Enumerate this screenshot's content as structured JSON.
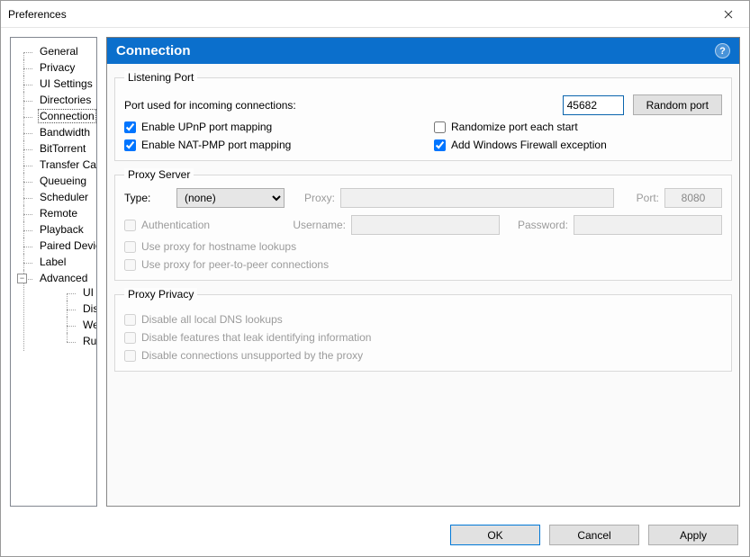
{
  "window": {
    "title": "Preferences"
  },
  "sidebar": {
    "items": [
      {
        "label": "General"
      },
      {
        "label": "Privacy"
      },
      {
        "label": "UI Settings"
      },
      {
        "label": "Directories"
      },
      {
        "label": "Connection",
        "selected": true
      },
      {
        "label": "Bandwidth"
      },
      {
        "label": "BitTorrent"
      },
      {
        "label": "Transfer Cap"
      },
      {
        "label": "Queueing"
      },
      {
        "label": "Scheduler"
      },
      {
        "label": "Remote"
      },
      {
        "label": "Playback"
      },
      {
        "label": "Paired Devices"
      },
      {
        "label": "Label"
      },
      {
        "label": "Advanced",
        "expanded": true,
        "children": [
          {
            "label": "UI Extras"
          },
          {
            "label": "Disk Cache"
          },
          {
            "label": "Web UI"
          },
          {
            "label": "Run Program"
          }
        ]
      }
    ]
  },
  "header": {
    "title": "Connection"
  },
  "listening_port": {
    "legend": "Listening Port",
    "port_label": "Port used for incoming connections:",
    "port_value": "45682",
    "random_button": "Random port",
    "upnp": {
      "label": "Enable UPnP port mapping",
      "checked": true
    },
    "natpmp": {
      "label": "Enable NAT-PMP port mapping",
      "checked": true
    },
    "randomize": {
      "label": "Randomize port each start",
      "checked": false
    },
    "firewall": {
      "label": "Add Windows Firewall exception",
      "checked": true
    }
  },
  "proxy_server": {
    "legend": "Proxy Server",
    "type_label": "Type:",
    "type_value": "(none)",
    "proxy_label": "Proxy:",
    "proxy_value": "",
    "port_label": "Port:",
    "port_value": "8080",
    "auth": {
      "label": "Authentication",
      "checked": false
    },
    "username_label": "Username:",
    "username_value": "",
    "password_label": "Password:",
    "password_value": "",
    "hostname": {
      "label": "Use proxy for hostname lookups",
      "checked": false
    },
    "p2p": {
      "label": "Use proxy for peer-to-peer connections",
      "checked": false
    }
  },
  "proxy_privacy": {
    "legend": "Proxy Privacy",
    "dns": {
      "label": "Disable all local DNS lookups",
      "checked": false
    },
    "leak": {
      "label": "Disable features that leak identifying information",
      "checked": false
    },
    "unsupported": {
      "label": "Disable connections unsupported by the proxy",
      "checked": false
    }
  },
  "footer": {
    "ok": "OK",
    "cancel": "Cancel",
    "apply": "Apply"
  }
}
